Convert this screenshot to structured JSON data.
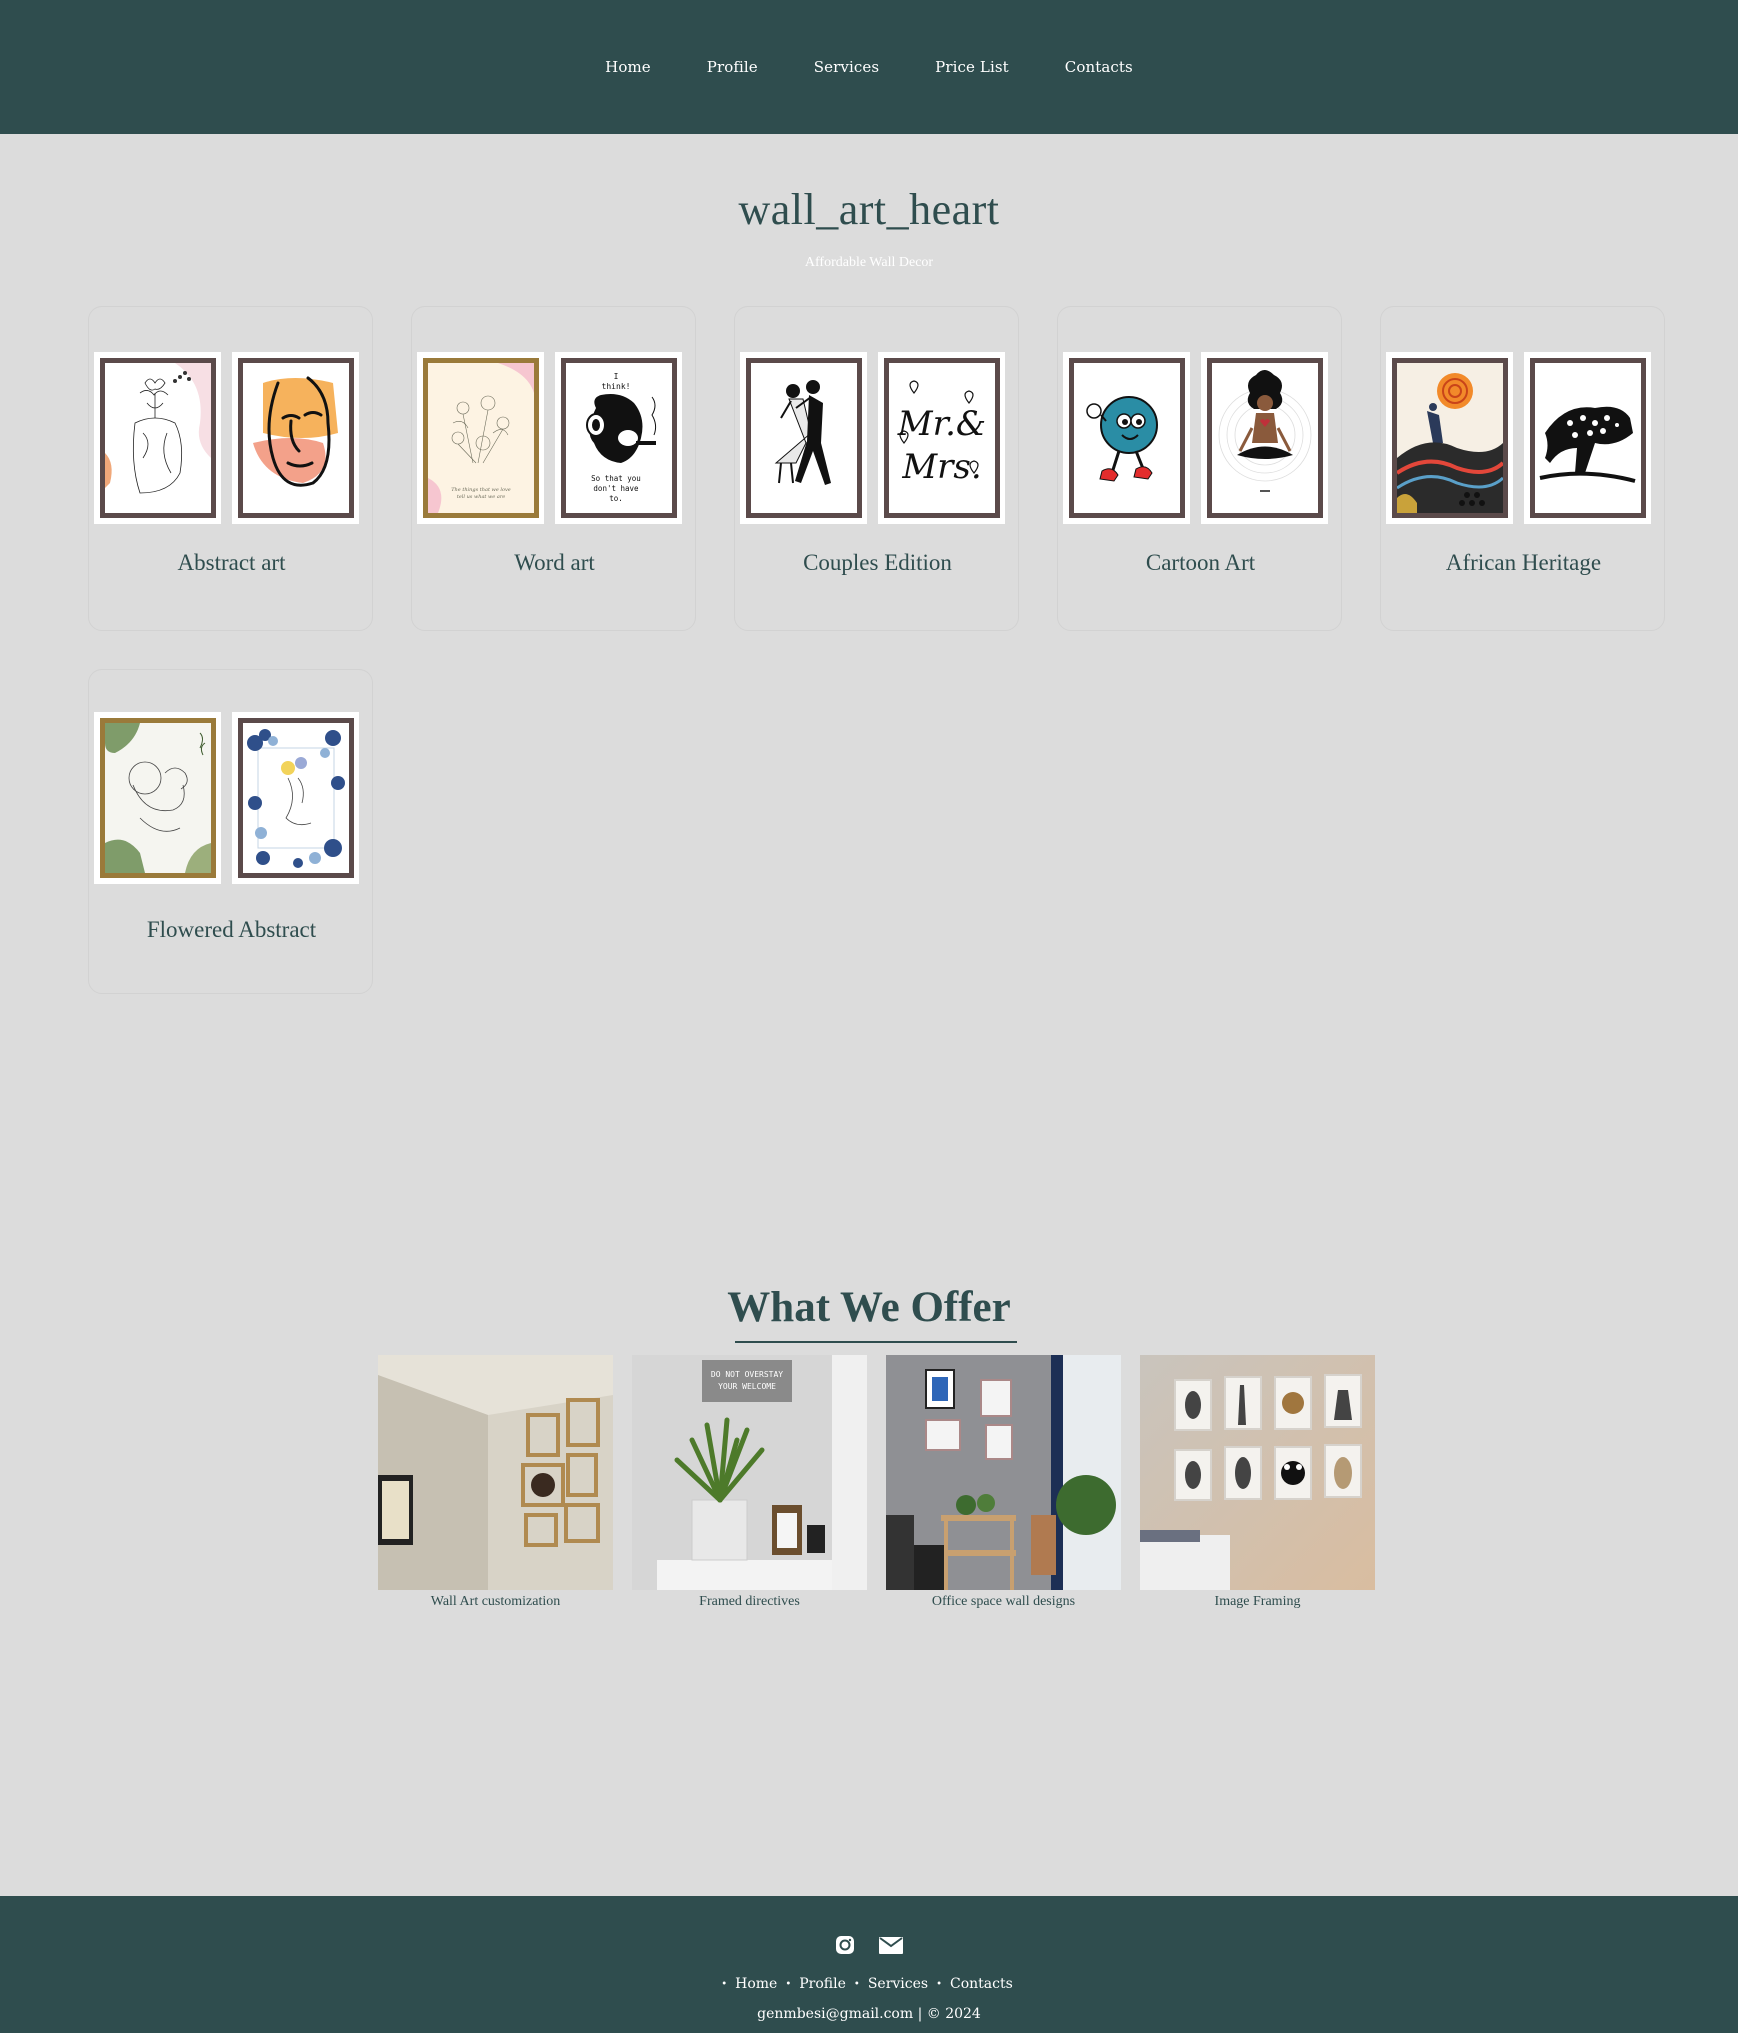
{
  "nav": {
    "items": [
      "Home",
      "Profile",
      "Services",
      "Price List",
      "Contacts"
    ]
  },
  "hero": {
    "title": "wall_art_heart",
    "subtitle": "Affordable Wall Decor"
  },
  "categories": [
    {
      "label": "Abstract art",
      "art": [
        "line-woman-flowers",
        "orange-face"
      ]
    },
    {
      "label": "Word art",
      "art": [
        "floral-line-text",
        "monkey-smoking"
      ]
    },
    {
      "label": "Couples Edition",
      "art": [
        "dancing-couple",
        "mr-and-mrs"
      ]
    },
    {
      "label": "Cartoon Art",
      "art": [
        "blue-globe-character",
        "meditating-woman"
      ]
    },
    {
      "label": "African Heritage",
      "art": [
        "sun-dancer",
        "leopard"
      ]
    },
    {
      "label": "Flowered Abstract",
      "art": [
        "green-line-portrait",
        "blue-floral-portrait"
      ]
    }
  ],
  "art_text": {
    "monkey_top": "I think!",
    "monkey_bottom_1": "So that you",
    "monkey_bottom_2": "don't have",
    "monkey_bottom_3": "to.",
    "mr_mrs": "Mr.& Mrs.",
    "floral_text": "The things that we love tell us what we are",
    "doormat_1": "DO NOT OVERSTAY",
    "doormat_2": "YOUR WELCOME"
  },
  "offer": {
    "title": "What We Offer",
    "items": [
      {
        "caption": "Wall Art customization"
      },
      {
        "caption": "Framed directives"
      },
      {
        "caption": "Office space wall designs"
      },
      {
        "caption": "Image Framing"
      }
    ]
  },
  "footer": {
    "icons": [
      "instagram-icon",
      "mail-icon"
    ],
    "links": [
      "Home",
      "Profile",
      "Services",
      "Contacts"
    ],
    "copyright": "genmbesi@gmail.com | © 2024"
  },
  "colors": {
    "header_bg": "#2f4d4e",
    "page_bg": "#dcdcdc",
    "accent": "#2f4d4e"
  }
}
